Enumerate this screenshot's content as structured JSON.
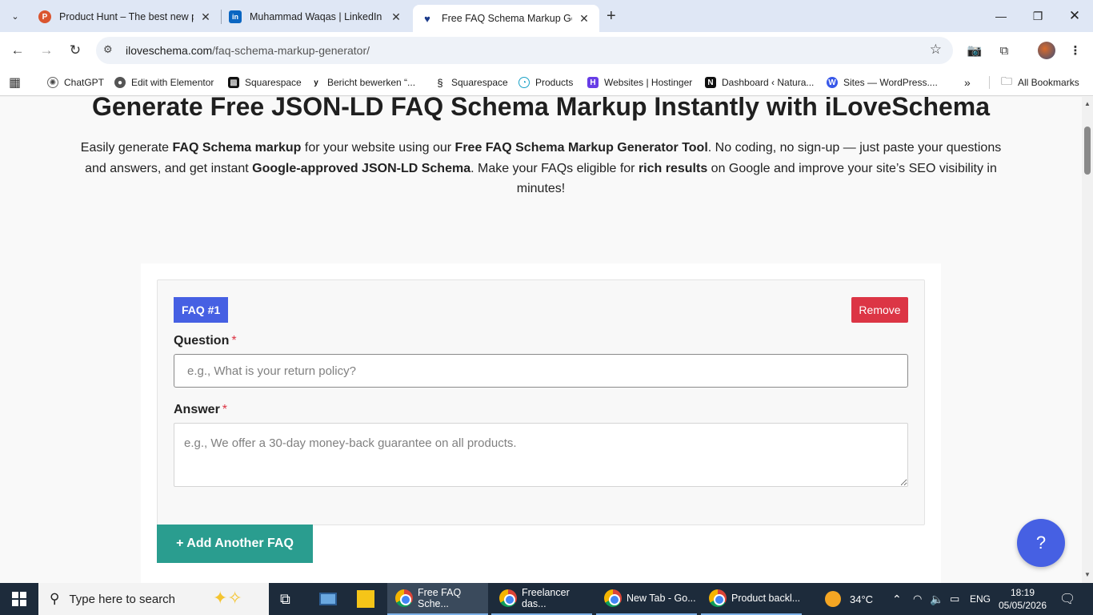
{
  "browser": {
    "tabs": [
      {
        "title": "Product Hunt – The best new p",
        "favicon": "P",
        "favicon_color": "#da552f",
        "active": false
      },
      {
        "title": "Muhammad Waqas | LinkedIn",
        "favicon": "in",
        "favicon_color": "#0a66c2",
        "active": false
      },
      {
        "title": "Free FAQ Schema Markup Gene",
        "favicon": "♥",
        "favicon_color": "#1a3a8a",
        "active": true
      }
    ],
    "url_host": "iloveschema.com",
    "url_path": "/faq-schema-markup-generator/",
    "bookmarks": [
      {
        "label": "ChatGPT",
        "icon": "chatgpt-icon",
        "color": "#444"
      },
      {
        "label": "Edit with Elementor",
        "icon": "globe-icon",
        "color": "#555"
      },
      {
        "label": "Squarespace",
        "icon": "squarespace-icon",
        "color": "#111"
      },
      {
        "label": "Bericht bewerken “...",
        "icon": "yoast-icon",
        "color": "#111"
      },
      {
        "label": "Squarespace",
        "icon": "squarespace-icon",
        "color": "#111"
      },
      {
        "label": "Products",
        "icon": "products-icon",
        "color": "#1aa1c6"
      },
      {
        "label": "Websites | Hostinger",
        "icon": "hostinger-icon",
        "color": "#673de6"
      },
      {
        "label": "Dashboard ‹ Natura...",
        "icon": "notion-icon",
        "color": "#111"
      },
      {
        "label": "Sites — WordPress....",
        "icon": "wordpress-icon",
        "color": "#3858e9"
      }
    ],
    "all_bookmarks": "All Bookmarks"
  },
  "page": {
    "headline": "Generate Free JSON-LD FAQ Schema Markup Instantly with iLoveSchema",
    "intro": {
      "p1": "Easily generate ",
      "b1": "FAQ Schema markup",
      "p2": " for your website using our ",
      "b2": "Free FAQ Schema Markup Generator Tool",
      "p3": ". No coding, no sign-up — just paste your questions and answers, and get instant ",
      "b3": "Google-approved JSON-LD Schema",
      "p4": ". Make your FAQs eligible for ",
      "b4": "rich results",
      "p5": " on Google and improve your site’s SEO visibility in minutes!"
    },
    "faq": {
      "badge": "FAQ #1",
      "remove_label": "Remove",
      "question_label": "Question",
      "question_placeholder": "e.g., What is your return policy?",
      "question_value": "",
      "answer_label": "Answer",
      "answer_placeholder": "e.g., We offer a 30-day money-back guarantee on all products.",
      "answer_value": "",
      "required_mark": "*"
    },
    "add_button": "+ Add Another FAQ",
    "help_button": "?",
    "colors": {
      "primary": "#4660e3",
      "danger": "#dc3545",
      "teal": "#2a9d8f"
    }
  },
  "taskbar": {
    "search_placeholder": "Type here to search",
    "tasks": [
      {
        "label": "Free FAQ Sche...",
        "active": true,
        "badge": "P"
      },
      {
        "label": "Freelancer das...",
        "active": false,
        "badge": "A"
      },
      {
        "label": "New Tab - Go...",
        "active": false,
        "badge": "M"
      },
      {
        "label": "Product backl...",
        "active": false,
        "badge": "d"
      }
    ],
    "weather": "34°C",
    "lang": "ENG",
    "time": "18:19",
    "date": "05/05/2026"
  }
}
